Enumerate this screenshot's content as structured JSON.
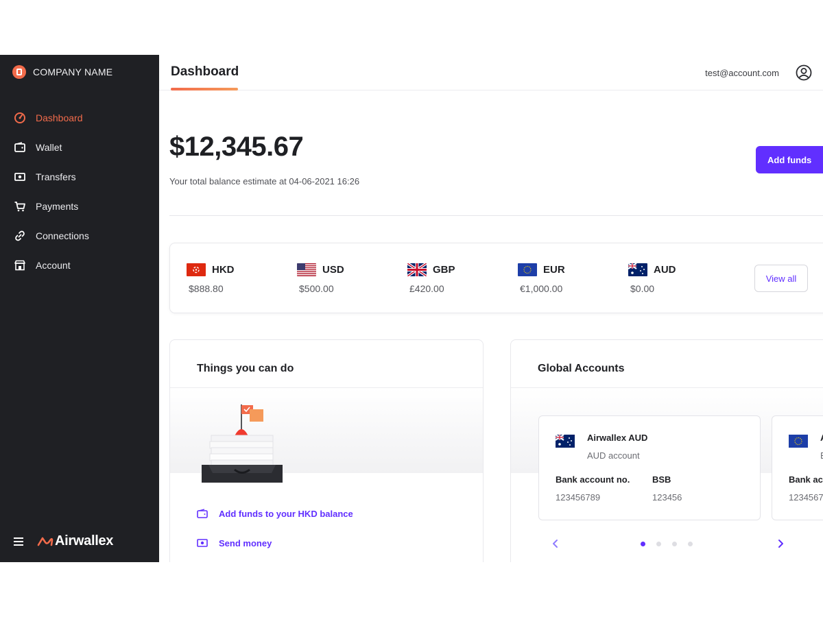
{
  "company": {
    "name": "COMPANY NAME"
  },
  "sidebar": {
    "items": [
      {
        "label": "Dashboard",
        "icon": "dashboard-icon",
        "active": true
      },
      {
        "label": "Wallet",
        "icon": "wallet-icon",
        "active": false
      },
      {
        "label": "Transfers",
        "icon": "transfers-icon",
        "active": false
      },
      {
        "label": "Payments",
        "icon": "cart-icon",
        "active": false
      },
      {
        "label": "Connections",
        "icon": "link-icon",
        "active": false
      },
      {
        "label": "Account",
        "icon": "store-icon",
        "active": false
      }
    ],
    "brand": "Airwallex"
  },
  "header": {
    "title": "Dashboard",
    "user_email": "test@account.com"
  },
  "balance": {
    "amount": "$12,345.67",
    "note": "Your total balance estimate at 04-06-2021 16:26",
    "add_funds_label": "Add funds"
  },
  "currencies": {
    "items": [
      {
        "code": "HKD",
        "amount": "$888.80",
        "flag": "hk-flag"
      },
      {
        "code": "USD",
        "amount": "$500.00",
        "flag": "us-flag"
      },
      {
        "code": "GBP",
        "amount": "£420.00",
        "flag": "gb-flag"
      },
      {
        "code": "EUR",
        "amount": "€1,000.00",
        "flag": "eu-flag"
      },
      {
        "code": "AUD",
        "amount": "$0.00",
        "flag": "au-flag"
      }
    ],
    "view_all_label": "View all"
  },
  "things": {
    "title": "Things you can do",
    "actions": [
      {
        "label": "Add funds to your HKD balance",
        "icon": "wallet-icon"
      },
      {
        "label": "Send money",
        "icon": "money-icon"
      }
    ]
  },
  "global_accounts": {
    "title": "Global Accounts",
    "accounts": [
      {
        "name": "Airwallex AUD",
        "subtitle": "AUD account",
        "bank_label": "Bank account no.",
        "bank_value": "123456789",
        "bsb_label": "BSB",
        "bsb_value": "123456",
        "flag": "au-flag"
      },
      {
        "name": "A",
        "subtitle": "E",
        "bank_label": "Bank acc",
        "bank_value": "1234567",
        "flag": "eu-flag"
      }
    ],
    "page_count": 4,
    "active_page": 1
  },
  "colors": {
    "sidebar_bg": "#1f2024",
    "accent_orange": "#f26b4b",
    "primary_purple": "#612fff"
  }
}
